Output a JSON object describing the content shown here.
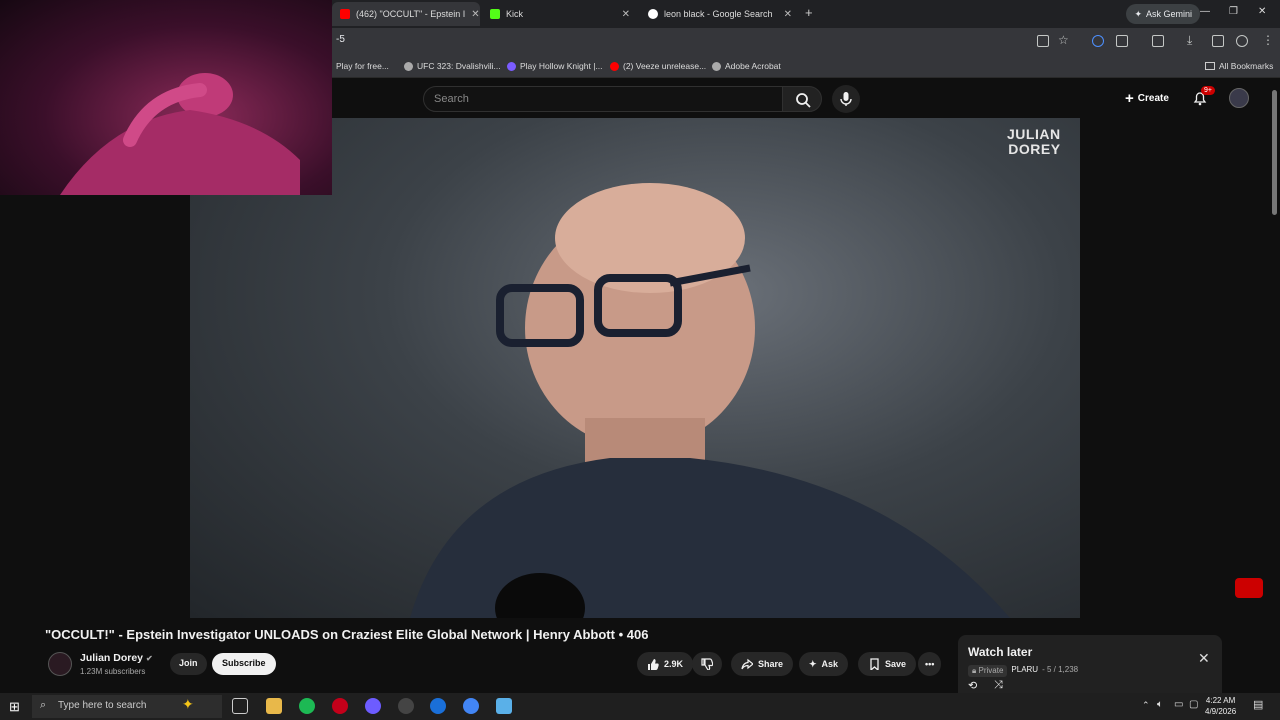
{
  "browser": {
    "tabs": [
      {
        "label": "(462) \"OCCULT\" - Epstein I",
        "favicon_color": "#ff0000",
        "active": true
      },
      {
        "label": "Kick",
        "favicon_color": "#53fc18",
        "active": false
      },
      {
        "label": "leon black - Google Search",
        "favicon_color": "#ffffff",
        "active": false
      }
    ],
    "ask_gemini_label": "Ask Gemini",
    "url": "-5",
    "bookmarks": [
      "Play for free...",
      "UFC 323: Dvalishvili...",
      "Play Hollow Knight |...",
      "(2) Veeze unrelease...",
      "Adobe Acrobat"
    ],
    "all_bookmarks_label": "All Bookmarks"
  },
  "youtube": {
    "search_placeholder": "Search",
    "create_label": "Create",
    "notifications_badge": "9+",
    "video_watermark_line1": "JULIAN",
    "video_watermark_line2": "DOREY",
    "title": "\"OCCULT!\" - Epstein Investigator UNLOADS on Craziest Elite Global Network | Henry Abbott • 406",
    "channel_name": "Julian Dorey",
    "subscribers": "1.23M subscribers",
    "join_label": "Join",
    "subscribe_label": "Subscribe",
    "like_count": "2.9K",
    "share_label": "Share",
    "ask_label": "Ask",
    "save_label": "Save"
  },
  "watch_later": {
    "title": "Watch later",
    "privacy": "Private",
    "owner": "PLARU",
    "position": "- 5 / 1,238"
  },
  "taskbar": {
    "search_placeholder": "Type here to search",
    "time": "4:22 AM",
    "date": "4/9/2026"
  },
  "colors": {
    "accent": "#cc0000",
    "bg": "#0f0f0f"
  }
}
